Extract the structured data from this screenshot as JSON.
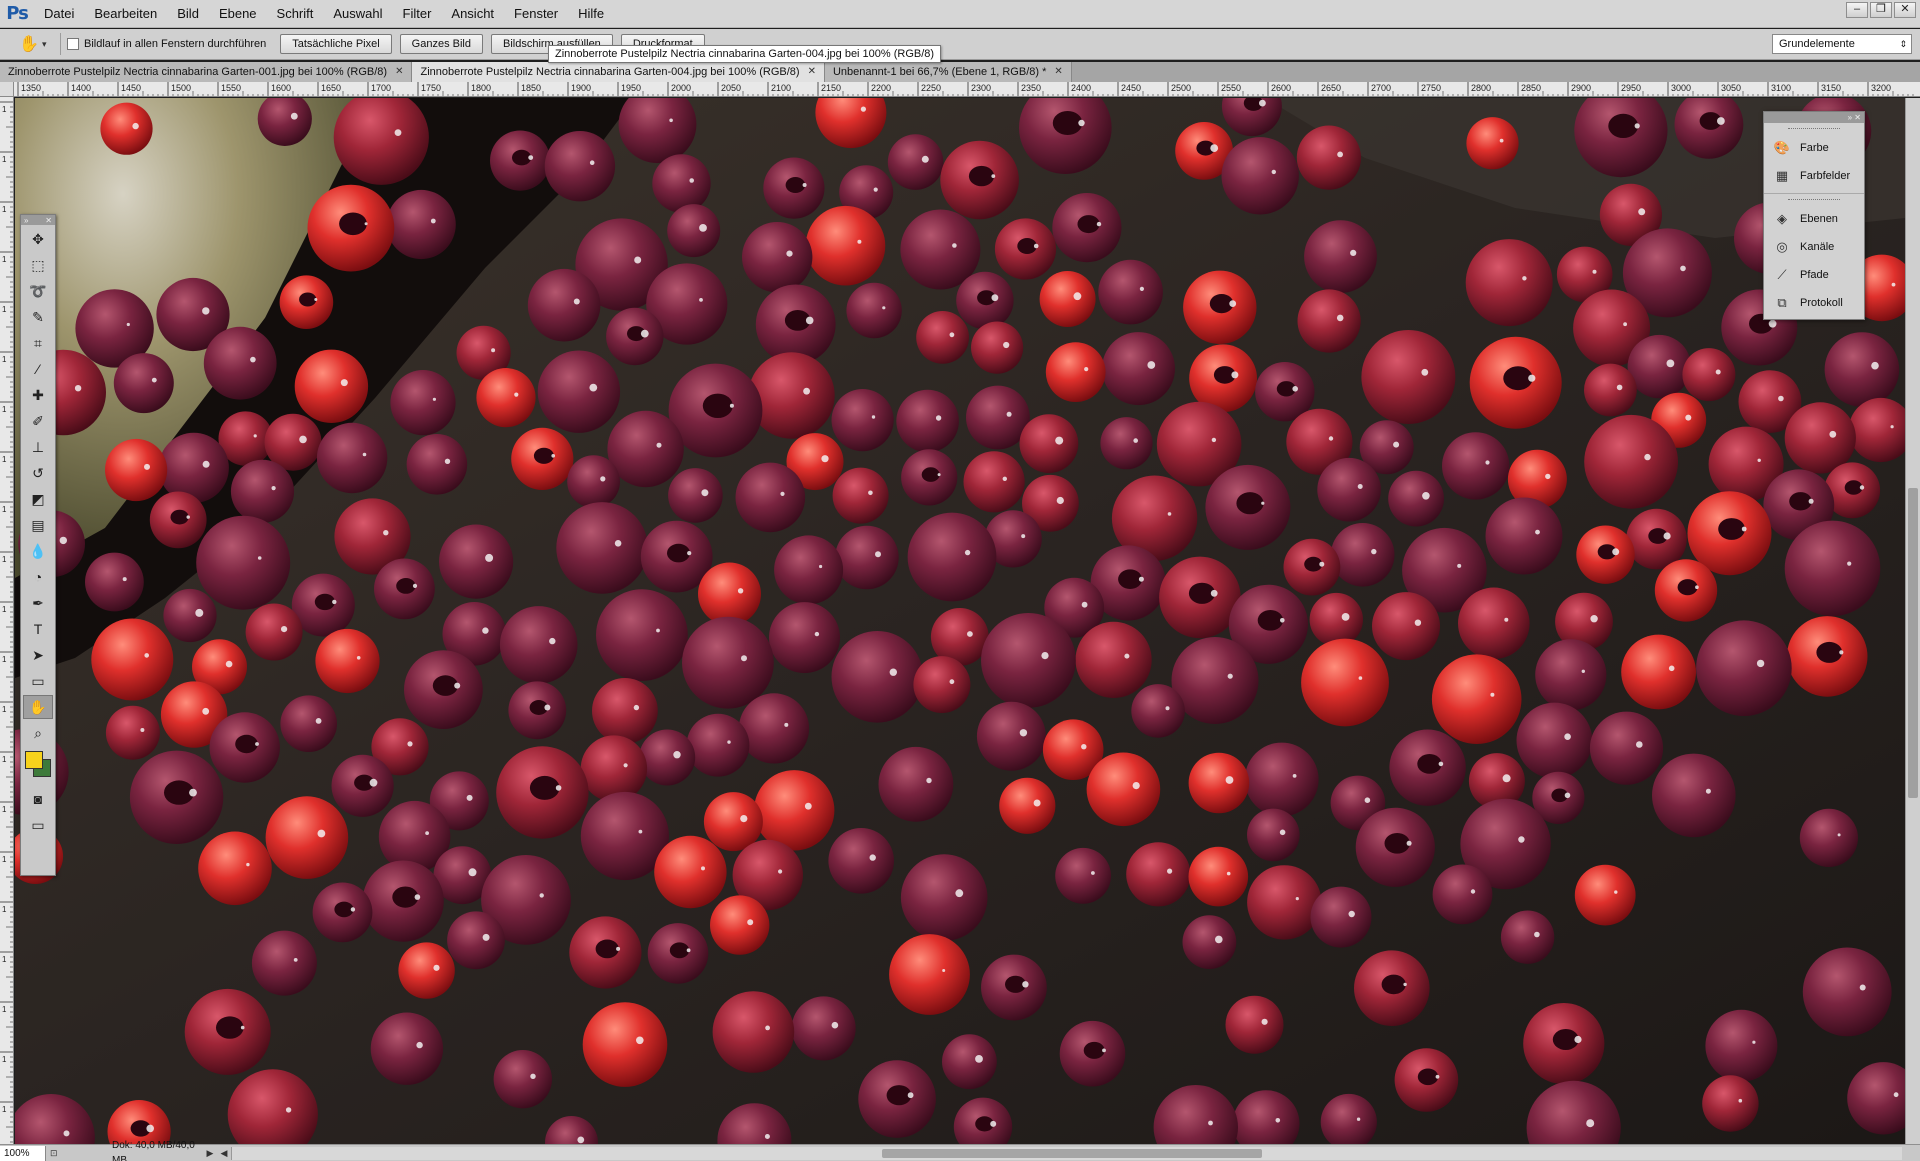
{
  "app": {
    "logo": "Ps"
  },
  "menu": [
    "Datei",
    "Bearbeiten",
    "Bild",
    "Ebene",
    "Schrift",
    "Auswahl",
    "Filter",
    "Ansicht",
    "Fenster",
    "Hilfe"
  ],
  "window_controls": {
    "minimize": "–",
    "restore": "❐",
    "close": "✕"
  },
  "options": {
    "checkbox_label": "Bildlauf in allen Fenstern durchführen",
    "buttons": [
      "Tatsächliche Pixel",
      "Ganzes Bild",
      "Bildschirm ausfüllen",
      "Druckformat"
    ],
    "workspace": "Grundelemente"
  },
  "tooltip": "Zinnoberrote Pustelpilz Nectria cinnabarina Garten-004.jpg bei 100% (RGB/8)",
  "tabs": [
    {
      "label": "Zinnoberrote Pustelpilz Nectria cinnabarina Garten-001.jpg bei 100% (RGB/8)",
      "active": false
    },
    {
      "label": "Zinnoberrote Pustelpilz Nectria cinnabarina Garten-004.jpg bei 100% (RGB/8)",
      "active": true
    },
    {
      "label": "Unbenannt-1 bei 66,7% (Ebene 1, RGB/8) *",
      "active": false
    }
  ],
  "ruler": {
    "top_labels": [
      "1350",
      "1400",
      "1450",
      "1500",
      "1550",
      "1600",
      "1650",
      "1700",
      "1750",
      "1800",
      "1850",
      "1900",
      "1950",
      "2000",
      "2050",
      "2100",
      "2150",
      "2200",
      "2250",
      "2300",
      "2350",
      "2400",
      "2450",
      "2500",
      "2550",
      "2600",
      "2650",
      "2700",
      "2750",
      "2800",
      "2850",
      "2900",
      "2950",
      "3000",
      "3050",
      "3100",
      "3150",
      "3200"
    ],
    "left_labels": [
      "1",
      "1",
      "1",
      "1",
      "1",
      "1",
      "1",
      "1",
      "1",
      "1",
      "1",
      "1",
      "1",
      "1",
      "1",
      "1",
      "1",
      "1",
      "1",
      "1",
      "1"
    ]
  },
  "status": {
    "zoom": "100%",
    "doc_info": "Dok: 40,0 MB/40,0 MB"
  },
  "tools": [
    {
      "name": "move-tool",
      "glyph": "✥"
    },
    {
      "name": "marquee-tool",
      "glyph": "⬚"
    },
    {
      "name": "lasso-tool",
      "glyph": "➰"
    },
    {
      "name": "quick-select-tool",
      "glyph": "✎"
    },
    {
      "name": "crop-tool",
      "glyph": "⌗"
    },
    {
      "name": "eyedropper-tool",
      "glyph": "⁄"
    },
    {
      "name": "healing-tool",
      "glyph": "✚"
    },
    {
      "name": "brush-tool",
      "glyph": "✐"
    },
    {
      "name": "stamp-tool",
      "glyph": "⊥"
    },
    {
      "name": "history-brush-tool",
      "glyph": "↺"
    },
    {
      "name": "eraser-tool",
      "glyph": "◩"
    },
    {
      "name": "gradient-tool",
      "glyph": "▤"
    },
    {
      "name": "blur-tool",
      "glyph": "💧"
    },
    {
      "name": "dodge-tool",
      "glyph": "◔"
    },
    {
      "name": "pen-tool",
      "glyph": "✒"
    },
    {
      "name": "type-tool",
      "glyph": "T"
    },
    {
      "name": "path-select-tool",
      "glyph": "➤"
    },
    {
      "name": "shape-tool",
      "glyph": "▭"
    },
    {
      "name": "hand-tool",
      "glyph": "✋"
    },
    {
      "name": "zoom-tool",
      "glyph": "⌕"
    }
  ],
  "colors": {
    "foreground": "#f7d21c",
    "background": "#3d7a3a",
    "accent": "#1f5ba8"
  },
  "dock": {
    "group1": [
      {
        "label": "Farbe",
        "icon": "palette-icon",
        "glyph": "🎨"
      },
      {
        "label": "Farbfelder",
        "icon": "swatches-icon",
        "glyph": "▦"
      }
    ],
    "group2": [
      {
        "label": "Ebenen",
        "icon": "layers-icon",
        "glyph": "◈"
      },
      {
        "label": "Kanäle",
        "icon": "channels-icon",
        "glyph": "◎"
      },
      {
        "label": "Pfade",
        "icon": "paths-icon",
        "glyph": "⟋"
      },
      {
        "label": "Protokoll",
        "icon": "history-icon",
        "glyph": "⧉"
      }
    ]
  }
}
